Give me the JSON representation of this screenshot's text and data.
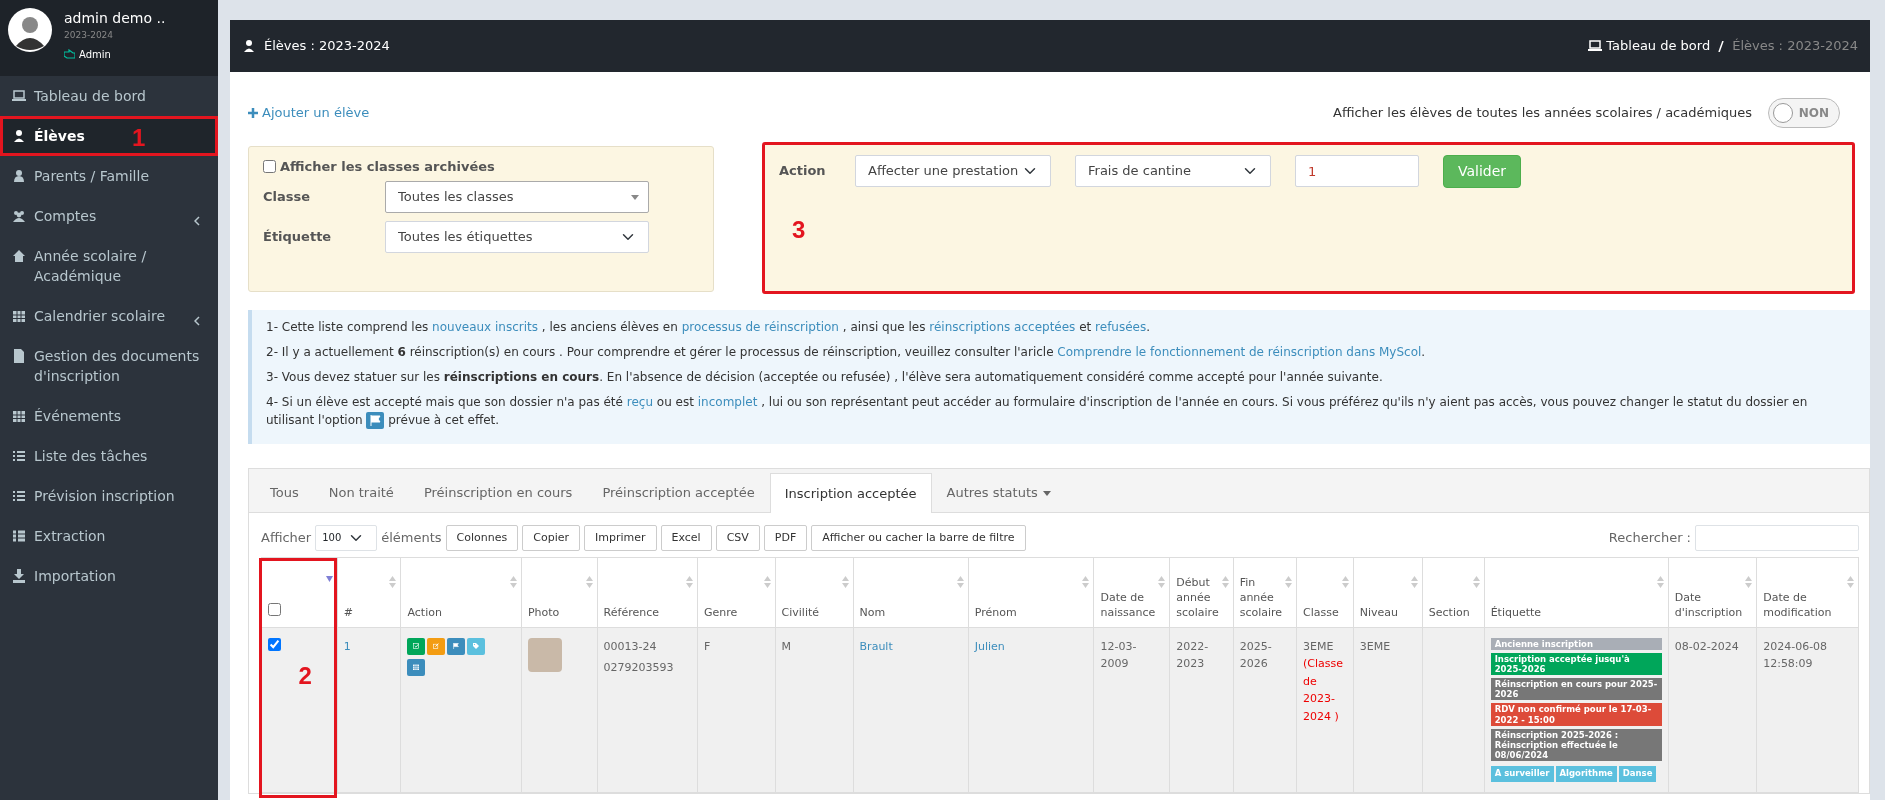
{
  "user": {
    "name": "admin demo ..",
    "year": "2023-2024",
    "role": "Admin"
  },
  "sidebar": {
    "items": [
      {
        "label": "Tableau de bord",
        "selected": false,
        "expandable": false
      },
      {
        "label": "Élèves",
        "selected": true,
        "expandable": false
      },
      {
        "label": "Parents / Famille",
        "selected": false,
        "expandable": false
      },
      {
        "label": "Comptes",
        "selected": false,
        "expandable": true
      },
      {
        "label": "Année scolaire / Académique",
        "selected": false,
        "expandable": false
      },
      {
        "label": "Calendrier scolaire",
        "selected": false,
        "expandable": true
      },
      {
        "label": "Gestion des documents d'inscription",
        "selected": false,
        "expandable": false
      },
      {
        "label": "Événements",
        "selected": false,
        "expandable": false
      },
      {
        "label": "Liste des tâches",
        "selected": false,
        "expandable": false
      },
      {
        "label": "Prévision inscription",
        "selected": false,
        "expandable": false
      },
      {
        "label": "Extraction",
        "selected": false,
        "expandable": false
      },
      {
        "label": "Importation",
        "selected": false,
        "expandable": false
      }
    ]
  },
  "header": {
    "title": "Élèves : 2023-2024",
    "breadcrumb": [
      "Tableau de bord",
      "Élèves : 2023-2024"
    ]
  },
  "add_link": "Ajouter un élève",
  "all_years_toggle": {
    "label": "Afficher les élèves de toutes les années scolaires / académiques",
    "text": "NON",
    "on": false
  },
  "filters": {
    "archived": {
      "label": "Afficher les classes archivées",
      "checked": false
    },
    "fields": [
      {
        "label": "Classe",
        "value": "Toutes les classes",
        "kind": "select2"
      },
      {
        "label": "Étiquette",
        "value": "Toutes les étiquettes",
        "kind": "select"
      }
    ]
  },
  "action_panel": {
    "label": "Action",
    "selects": [
      "Affecter une prestation",
      "Frais de cantine"
    ],
    "quantity": "1",
    "button": "Valider"
  },
  "info": [
    [
      {
        "kind": "text",
        "text": "1- Cette liste comprend les "
      },
      {
        "kind": "link",
        "text": "nouveaux inscrits"
      },
      {
        "kind": "text",
        "text": " , les anciens élèves en "
      },
      {
        "kind": "link",
        "text": "processus de réinscription"
      },
      {
        "kind": "text",
        "text": " , ainsi que les "
      },
      {
        "kind": "link",
        "text": "réinscriptions acceptées"
      },
      {
        "kind": "text",
        "text": " et "
      },
      {
        "kind": "link",
        "text": "refusées"
      },
      {
        "kind": "text",
        "text": "."
      }
    ],
    [
      {
        "kind": "text",
        "text": "2- Il y a actuellement **6** réinscription(s) en cours . Pour comprendre et gérer le processus de réinscription, veuillez consulter l'aricle "
      },
      {
        "kind": "link",
        "text": "Comprendre le fonctionnement de réinscription dans MyScol"
      },
      {
        "kind": "text",
        "text": "."
      }
    ],
    [
      {
        "kind": "text",
        "text": "3- Vous devez statuer sur les **réinscriptions en cours**. En l'absence de décision (acceptée ou refusée) , l'élève sera automatiquement considéré comme accepté pour l'année suivante."
      }
    ],
    [
      {
        "kind": "text",
        "text": "4- Si un élève est accepté mais que son dossier n'a pas été "
      },
      {
        "kind": "link",
        "text": "reçu"
      },
      {
        "kind": "text",
        "text": " ou est "
      },
      {
        "kind": "link",
        "text": "incomplet"
      },
      {
        "kind": "text",
        "text": " , lui ou son représentant peut accéder au formulaire d'inscription de l'année en cours. Si vous préférez qu'ils n'y aient pas accès, vous pouvez changer le statut du dossier en utilisant l'option "
      },
      {
        "kind": "flag"
      },
      {
        "kind": "text",
        "text": " prévue à cet effet."
      }
    ]
  ],
  "tabs": [
    {
      "label": "Tous",
      "selected": false,
      "dropdown": false
    },
    {
      "label": "Non traité",
      "selected": false,
      "dropdown": false
    },
    {
      "label": "Préinscription en cours",
      "selected": false,
      "dropdown": false
    },
    {
      "label": "Préinscription acceptée",
      "selected": false,
      "dropdown": false
    },
    {
      "label": "Inscription acceptée",
      "selected": true,
      "dropdown": false
    },
    {
      "label": "Autres statuts",
      "selected": false,
      "dropdown": true
    }
  ],
  "toolbar": {
    "show_label": "Afficher",
    "page_size": "100",
    "after_label": "éléments",
    "buttons": [
      "Colonnes",
      "Copier",
      "Imprimer",
      "Excel",
      "CSV",
      "PDF",
      "Afficher ou cacher la barre de filtre"
    ],
    "search_label": "Rechercher :"
  },
  "table": {
    "columns": [
      {
        "sorted": true
      },
      {
        "label": "#",
        "sorted": false
      },
      {
        "label": "Action",
        "sorted": false
      },
      {
        "label": "Photo",
        "sorted": false
      },
      {
        "label": "Référence",
        "sorted": false
      },
      {
        "label": "Genre",
        "sorted": false
      },
      {
        "label": "Civilité",
        "sorted": false
      },
      {
        "label": "Nom",
        "sorted": false
      },
      {
        "label": "Prénom",
        "sorted": false
      },
      {
        "label": "Date de naissance",
        "sorted": false
      },
      {
        "label": "Début année scolaire",
        "sorted": false
      },
      {
        "label": "Fin année scolaire",
        "sorted": false
      },
      {
        "label": "Classe",
        "sorted": false
      },
      {
        "label": "Niveau",
        "sorted": false
      },
      {
        "label": "Section",
        "sorted": false
      },
      {
        "label": "Étiquette",
        "sorted": false
      },
      {
        "label": "Date d'inscription",
        "sorted": false
      },
      {
        "label": "Date de modification",
        "sorted": false
      }
    ],
    "select_all": {
      "checked": false
    },
    "rows": [
      {
        "checked": true,
        "number": "1",
        "reference": [
          "00013-24",
          "0279203593"
        ],
        "genre": "F",
        "civilite": "M",
        "nom": "Brault",
        "prenom": "Julien",
        "naissance": "12-03-2009",
        "debut": "2022-2023",
        "fin": "2025-2026",
        "classe": "3EME",
        "classe_note": "(Classe de 2023-2024 )",
        "niveau": "3EME",
        "tags": [
          {
            "text": "Ancienne inscription",
            "color": "#a9aeb6"
          },
          {
            "text": "Inscription acceptée jusqu'à 2025-2026",
            "color": "#00a65a"
          },
          {
            "text": "Réinscription en cours pour 2025-2026",
            "color": "#777777"
          },
          {
            "text": "RDV non confirmé pour le 17-03-2022 - 15:00",
            "color": "#dd4b39"
          },
          {
            "text": "Réinscription 2025-2026 : Réinscription effectuée le 08/06/2024",
            "color": "#777777"
          },
          {
            "text": "A surveiller",
            "color": "#5bc0de"
          },
          {
            "text": "Algorithme",
            "color": "#5bc0de"
          },
          {
            "text": "Danse",
            "color": "#5bc0de"
          }
        ],
        "inscription": "08-02-2024",
        "modification": "2024-06-08 12:58:09"
      }
    ]
  },
  "annotations": {
    "sidebar_item": "1",
    "checkbox_column": "2",
    "action_panel": "3"
  }
}
